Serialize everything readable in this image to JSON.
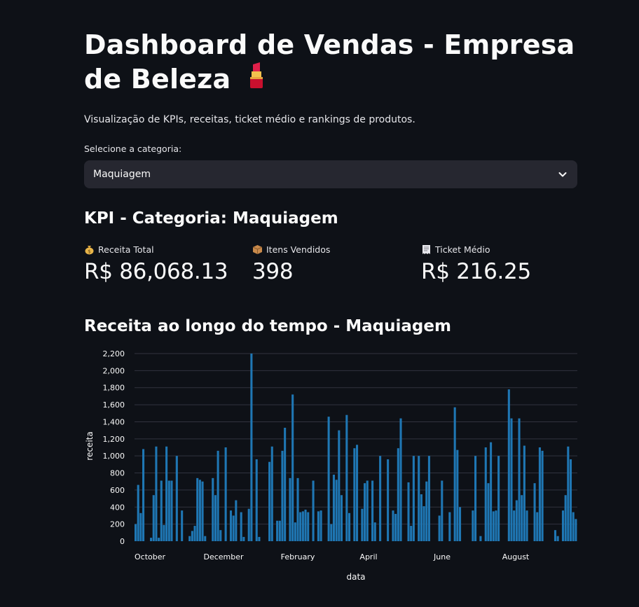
{
  "header": {
    "title": "Dashboard de Vendas - Empresa de Beleza",
    "title_icon": "lipstick-icon",
    "subtitle": "Visualização de KPIs, receitas, ticket médio e rankings de produtos."
  },
  "category_select": {
    "label": "Selecione a categoria:",
    "value": "Maquiagem",
    "icon": "chevron-down-icon"
  },
  "kpi_section": {
    "title": "KPI - Categoria: Maquiagem",
    "metrics": [
      {
        "label": "Receita Total",
        "value": "R$ 86,068.13",
        "icon": "money-bag-icon"
      },
      {
        "label": "Itens Vendidos",
        "value": "398",
        "icon": "package-icon"
      },
      {
        "label": "Ticket Médio",
        "value": "R$ 216.25",
        "icon": "receipt-icon"
      }
    ]
  },
  "chart_section": {
    "title": "Receita ao longo do tempo - Maquiagem"
  },
  "colors": {
    "background": "#0e1117",
    "bar": "#1f77b4",
    "grid": "#31333f",
    "select_bg": "#262730"
  },
  "chart_data": {
    "type": "bar",
    "xlabel": "data",
    "ylabel": "receita",
    "ylim": [
      0,
      2200
    ],
    "yticks": [
      0,
      200,
      400,
      600,
      800,
      1000,
      1200,
      1400,
      1600,
      1800,
      2000,
      2200
    ],
    "ytick_labels": [
      "0",
      "200",
      "400",
      "600",
      "800",
      "1,000",
      "1,200",
      "1,400",
      "1,600",
      "1,800",
      "2,000",
      "2,200"
    ],
    "xtick_labels": [
      "October",
      "December",
      "February",
      "April",
      "June",
      "August"
    ],
    "grid": true,
    "values": [
      200,
      660,
      330,
      1080,
      0,
      0,
      40,
      540,
      1110,
      40,
      710,
      190,
      1110,
      710,
      710,
      0,
      1000,
      0,
      360,
      0,
      0,
      60,
      120,
      180,
      740,
      720,
      700,
      60,
      0,
      0,
      740,
      540,
      1060,
      130,
      0,
      1100,
      0,
      360,
      300,
      480,
      0,
      340,
      50,
      0,
      380,
      2200,
      0,
      960,
      50,
      0,
      0,
      0,
      930,
      1110,
      0,
      240,
      240,
      1060,
      1330,
      0,
      740,
      1720,
      220,
      740,
      340,
      350,
      370,
      340,
      0,
      710,
      0,
      350,
      360,
      0,
      0,
      1460,
      200,
      780,
      720,
      1300,
      540,
      0,
      1480,
      330,
      0,
      1090,
      1130,
      0,
      380,
      680,
      710,
      0,
      710,
      220,
      0,
      1000,
      0,
      0,
      960,
      0,
      360,
      320,
      1090,
      1440,
      0,
      0,
      690,
      180,
      1000,
      0,
      1000,
      550,
      410,
      700,
      1000,
      0,
      0,
      0,
      300,
      710,
      0,
      0,
      340,
      0,
      1570,
      1070,
      400,
      0,
      0,
      0,
      0,
      360,
      1000,
      0,
      60,
      0,
      1100,
      680,
      1160,
      350,
      360,
      1000,
      0,
      0,
      0,
      1780,
      1440,
      360,
      480,
      1440,
      540,
      1120,
      360,
      0,
      0,
      680,
      340,
      1100,
      1060,
      0,
      0,
      0,
      0,
      130,
      60,
      0,
      360,
      540,
      1110,
      960,
      340,
      260
    ]
  }
}
